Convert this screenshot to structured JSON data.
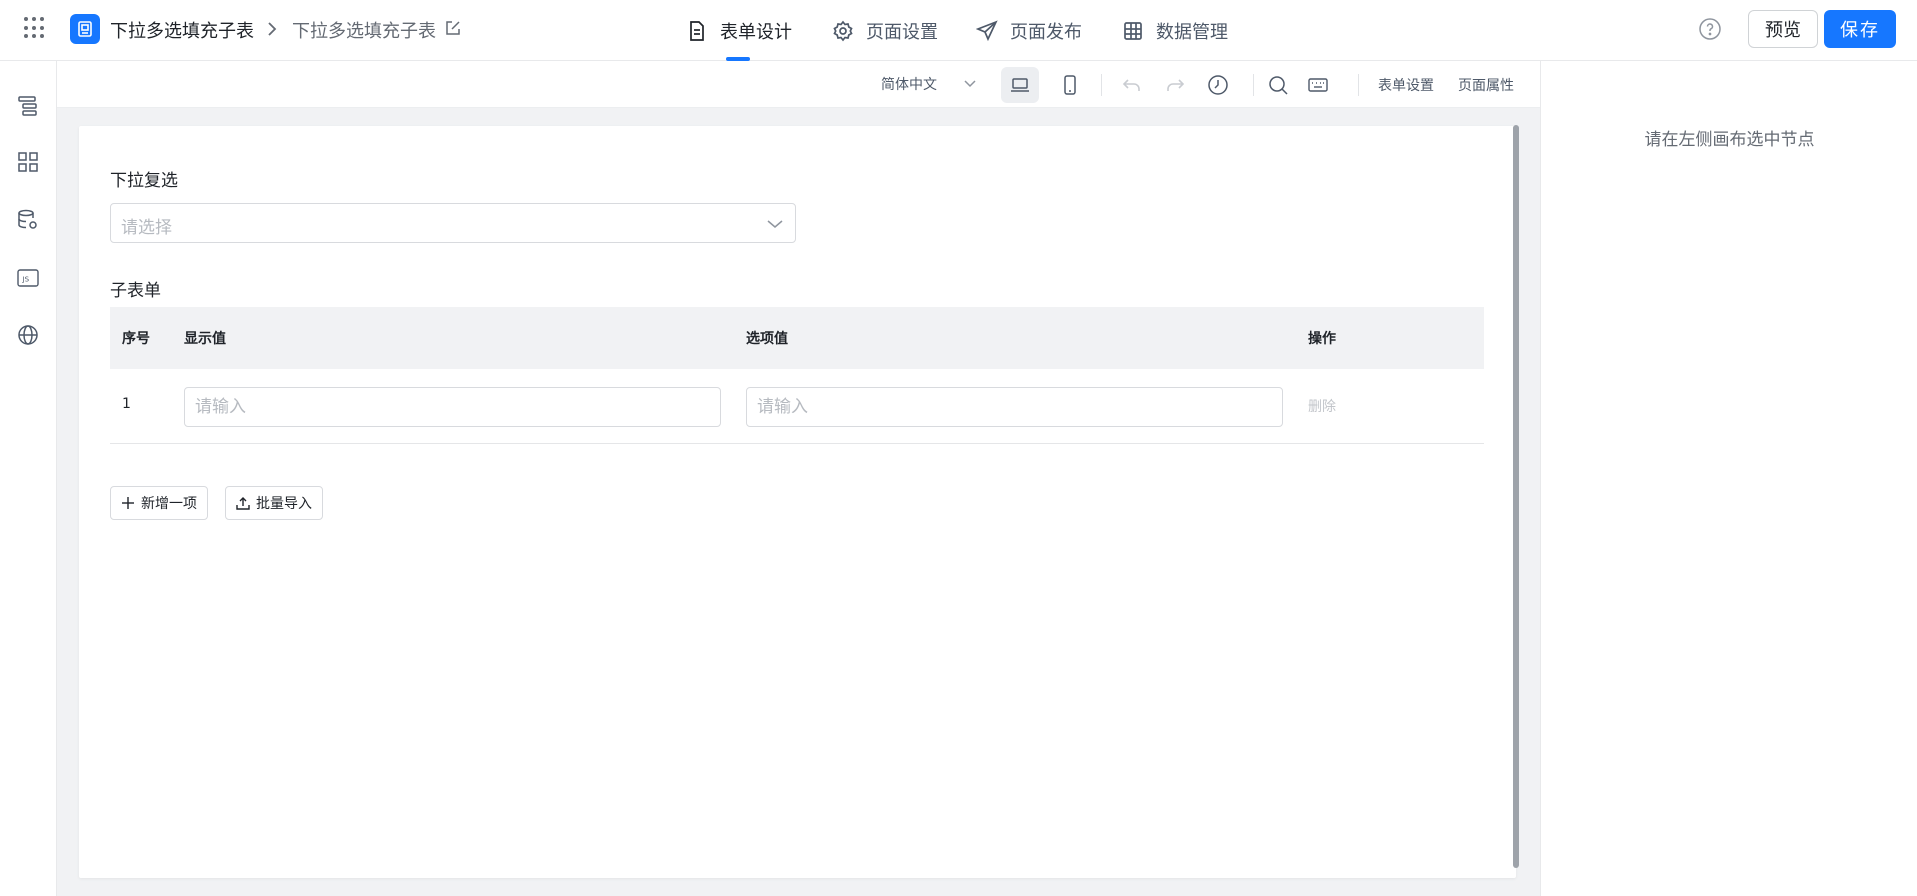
{
  "header": {
    "breadcrumb_app": "下拉多选填充子表",
    "breadcrumb_page": "下拉多选填充子表",
    "nav": [
      {
        "label": "表单设计",
        "icon": "file-text-icon",
        "active": true
      },
      {
        "label": "页面设置",
        "icon": "gear-icon",
        "active": false
      },
      {
        "label": "页面发布",
        "icon": "send-icon",
        "active": false
      },
      {
        "label": "数据管理",
        "icon": "table-grid-icon",
        "active": false
      }
    ],
    "preview_label": "预览",
    "save_label": "保存"
  },
  "left_rail": [
    "outline-tree-icon",
    "components-grid-icon",
    "data-source-icon",
    "js-code-icon",
    "globe-icon"
  ],
  "toolbar": {
    "language": "简体中文",
    "form_settings": "表单设置",
    "page_properties": "页面属性"
  },
  "form": {
    "multi_select_label": "下拉复选",
    "multi_select_placeholder": "请选择",
    "subform_label": "子表单",
    "columns": {
      "index": "序号",
      "display": "显示值",
      "value": "选项值",
      "action": "操作"
    },
    "rows": [
      {
        "index": "1",
        "display_placeholder": "请输入",
        "value_placeholder": "请输入",
        "delete_label": "删除"
      }
    ],
    "add_item_label": "新增一项",
    "batch_import_label": "批量导入"
  },
  "right_panel": {
    "hint": "请在左侧画布选中节点"
  },
  "colors": {
    "primary": "#1677ff",
    "canvas_bg": "#f1f2f4",
    "placeholder": "#b6bac0"
  }
}
